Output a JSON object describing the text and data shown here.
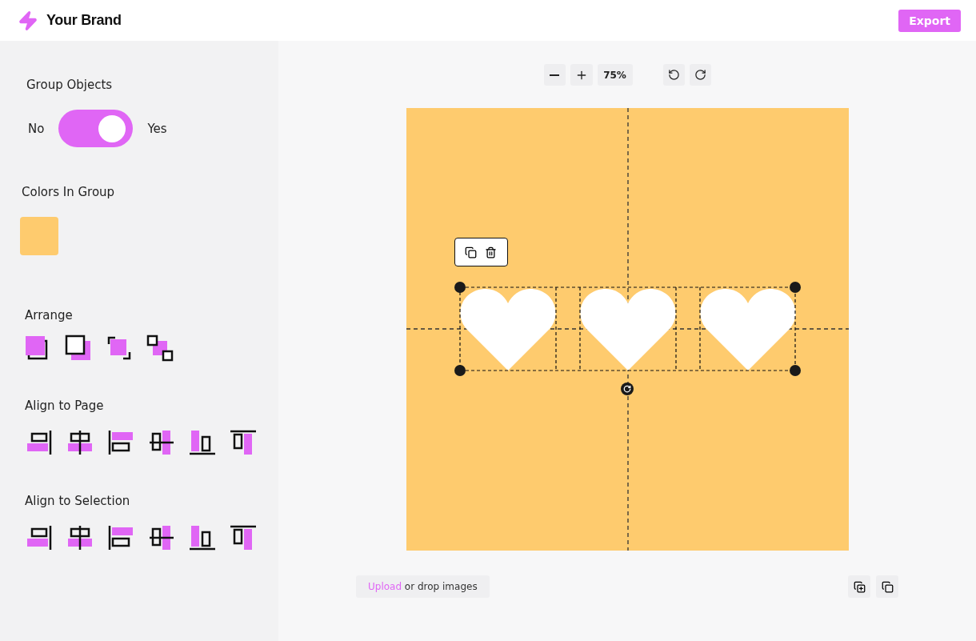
{
  "header": {
    "brand": "Your Brand",
    "export_button": "Export"
  },
  "sidebar": {
    "group_objects": {
      "label": "Group Objects",
      "off_label": "No",
      "on_label": "Yes",
      "on": true
    },
    "colors": {
      "label": "Colors In Group",
      "swatches": [
        {
          "color": "#fecb6e"
        }
      ]
    },
    "arrange": {
      "label": "Arrange"
    },
    "align_page": {
      "label": "Align to Page"
    },
    "align_selection": {
      "label": "Align to Selection"
    }
  },
  "zoom_toolbar": {
    "zoom": "75%"
  },
  "upload": {
    "link": "Upload",
    "text": " or drop images"
  }
}
